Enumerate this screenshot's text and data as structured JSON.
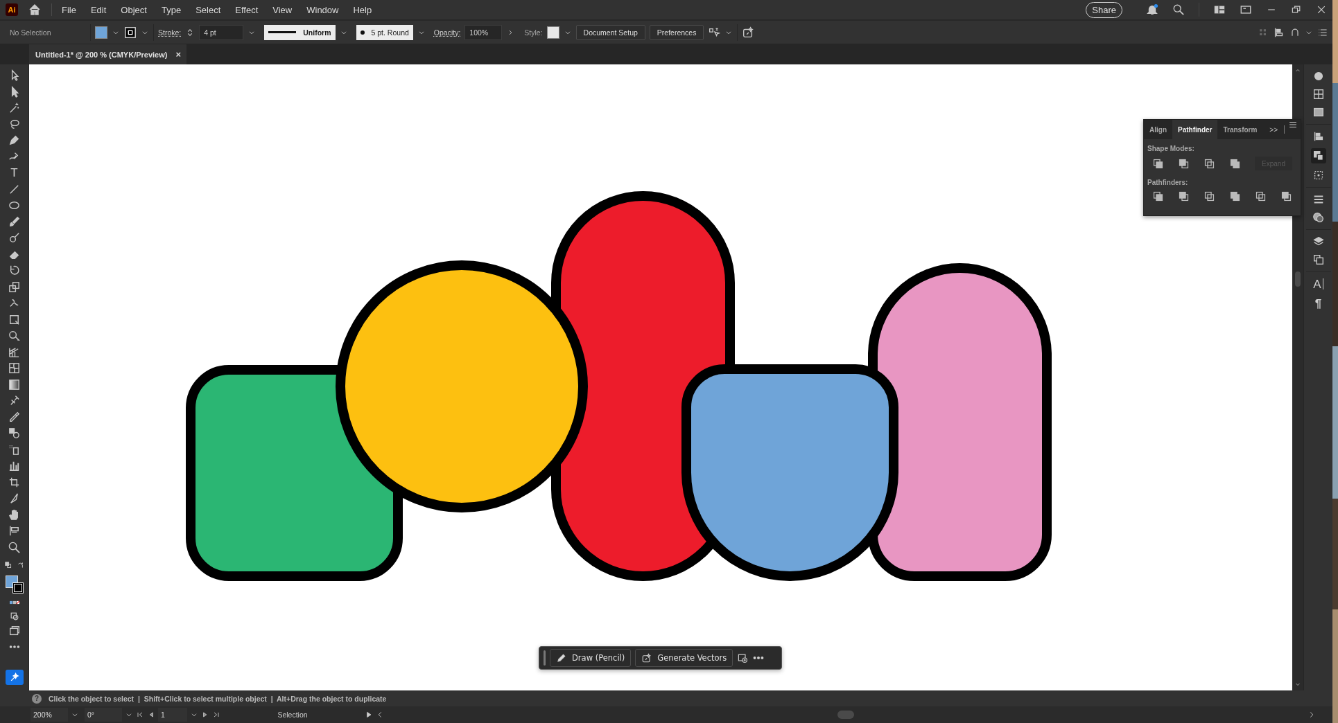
{
  "app": {
    "logo": "Ai"
  },
  "menu": [
    "File",
    "Edit",
    "Object",
    "Type",
    "Select",
    "Effect",
    "View",
    "Window",
    "Help"
  ],
  "share_button": "Share",
  "control_bar": {
    "selection": "No Selection",
    "fill": {
      "color": "#6fa4d8"
    },
    "stroke_label": "Stroke:",
    "stroke_weight": "4 pt",
    "stroke_profile": "Uniform",
    "brush": "5 pt. Round",
    "opacity_label": "Opacity:",
    "opacity": "100%",
    "style_label": "Style:",
    "buttons": [
      "Document Setup",
      "Preferences"
    ]
  },
  "document_tab": {
    "title": "Untitled-1* @ 200 % (CMYK/Preview)",
    "close": "×"
  },
  "toolbar": {
    "type_tool": "T",
    "fill": {
      "color": "#6fa4d8"
    }
  },
  "canvas": {
    "shapes": [
      {
        "kind": "rounded-square",
        "color": "#2bb673"
      },
      {
        "kind": "pill",
        "color": "#ed1c2b"
      },
      {
        "kind": "circle",
        "color": "#fdc010"
      },
      {
        "kind": "arch",
        "color": "#e896c2"
      },
      {
        "kind": "bowl",
        "color": "#6fa4d8"
      }
    ]
  },
  "pathfinder_panel": {
    "tabs": [
      {
        "label": "Align",
        "selected": false
      },
      {
        "label": "Pathfinder",
        "selected": true
      },
      {
        "label": "Transform",
        "selected": false
      }
    ],
    "more": ">>",
    "shape_modes_label": "Shape Modes:",
    "expand": {
      "label": "Expand",
      "disabled": true
    },
    "pathfinders_label": "Pathfinders:"
  },
  "context_bar": {
    "buttons": [
      "Draw (Pencil)",
      "Generate Vectors"
    ]
  },
  "right_dock": {
    "character_glyph": "A",
    "paragraph_glyph": "¶"
  },
  "status": {
    "help": "?",
    "hint": "Click the object to select  |  Shift+Click to select multiple object  |  Alt+Drag the object to duplicate",
    "zoom": "200%",
    "rotation": "0°",
    "artboard": "1",
    "mode": "Selection"
  }
}
